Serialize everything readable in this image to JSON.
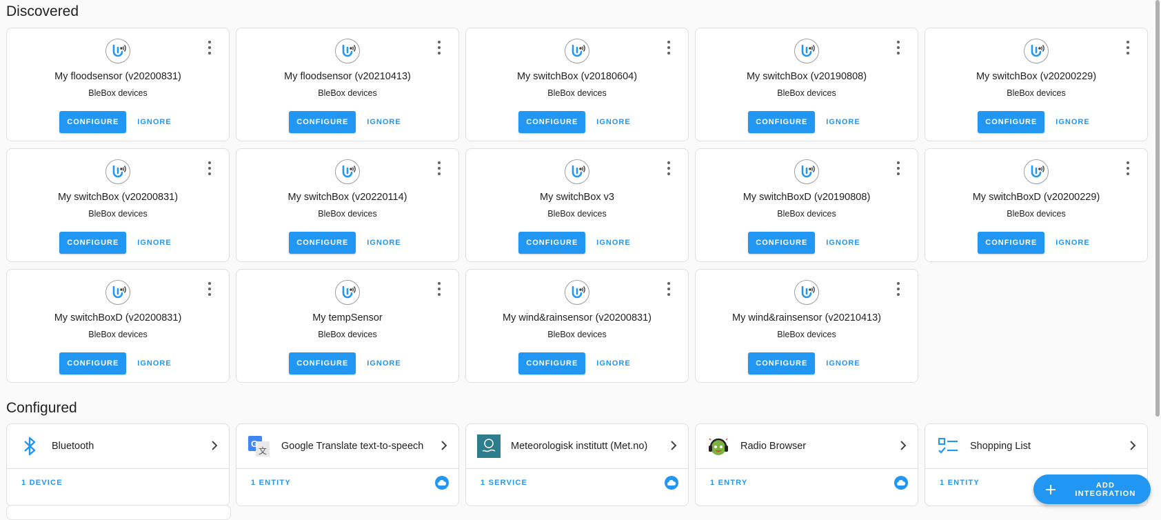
{
  "discovered": {
    "title": "Discovered",
    "configure_label": "CONFIGURE",
    "ignore_label": "IGNORE",
    "items": [
      {
        "name": "My floodsensor (v20200831)",
        "subtitle": "BleBox devices"
      },
      {
        "name": "My floodsensor (v20210413)",
        "subtitle": "BleBox devices"
      },
      {
        "name": "My switchBox (v20180604)",
        "subtitle": "BleBox devices"
      },
      {
        "name": "My switchBox (v20190808)",
        "subtitle": "BleBox devices"
      },
      {
        "name": "My switchBox (v20200229)",
        "subtitle": "BleBox devices"
      },
      {
        "name": "My switchBox (v20200831)",
        "subtitle": "BleBox devices"
      },
      {
        "name": "My switchBox (v20220114)",
        "subtitle": "BleBox devices"
      },
      {
        "name": "My switchBox v3",
        "subtitle": "BleBox devices"
      },
      {
        "name": "My switchBoxD (v20190808)",
        "subtitle": "BleBox devices"
      },
      {
        "name": "My switchBoxD (v20200229)",
        "subtitle": "BleBox devices"
      },
      {
        "name": "My switchBoxD (v20200831)",
        "subtitle": "BleBox devices"
      },
      {
        "name": "My tempSensor",
        "subtitle": "BleBox devices"
      },
      {
        "name": "My wind&rainsensor (v20200831)",
        "subtitle": "BleBox devices"
      },
      {
        "name": "My wind&rainsensor (v20210413)",
        "subtitle": "BleBox devices"
      }
    ]
  },
  "configured": {
    "title": "Configured",
    "items": [
      {
        "name": "Bluetooth",
        "link": "1 DEVICE",
        "icon": "bluetooth-icon",
        "cloud": false
      },
      {
        "name": "Google Translate text-to-speech",
        "link": "1 ENTITY",
        "icon": "google-translate-icon",
        "cloud": true
      },
      {
        "name": "Meteorologisk institutt (Met.no)",
        "link": "1 SERVICE",
        "icon": "met-no-icon",
        "cloud": true
      },
      {
        "name": "Radio Browser",
        "link": "1 ENTRY",
        "icon": "radio-browser-icon",
        "cloud": true
      },
      {
        "name": "Shopping List",
        "link": "1 ENTITY",
        "icon": "shopping-list-icon",
        "cloud": false
      }
    ]
  },
  "fab": {
    "label": "ADD INTEGRATION"
  },
  "colors": {
    "accent": "#2196f3",
    "background": "#fafafa",
    "card_border": "#e0e0e0"
  }
}
